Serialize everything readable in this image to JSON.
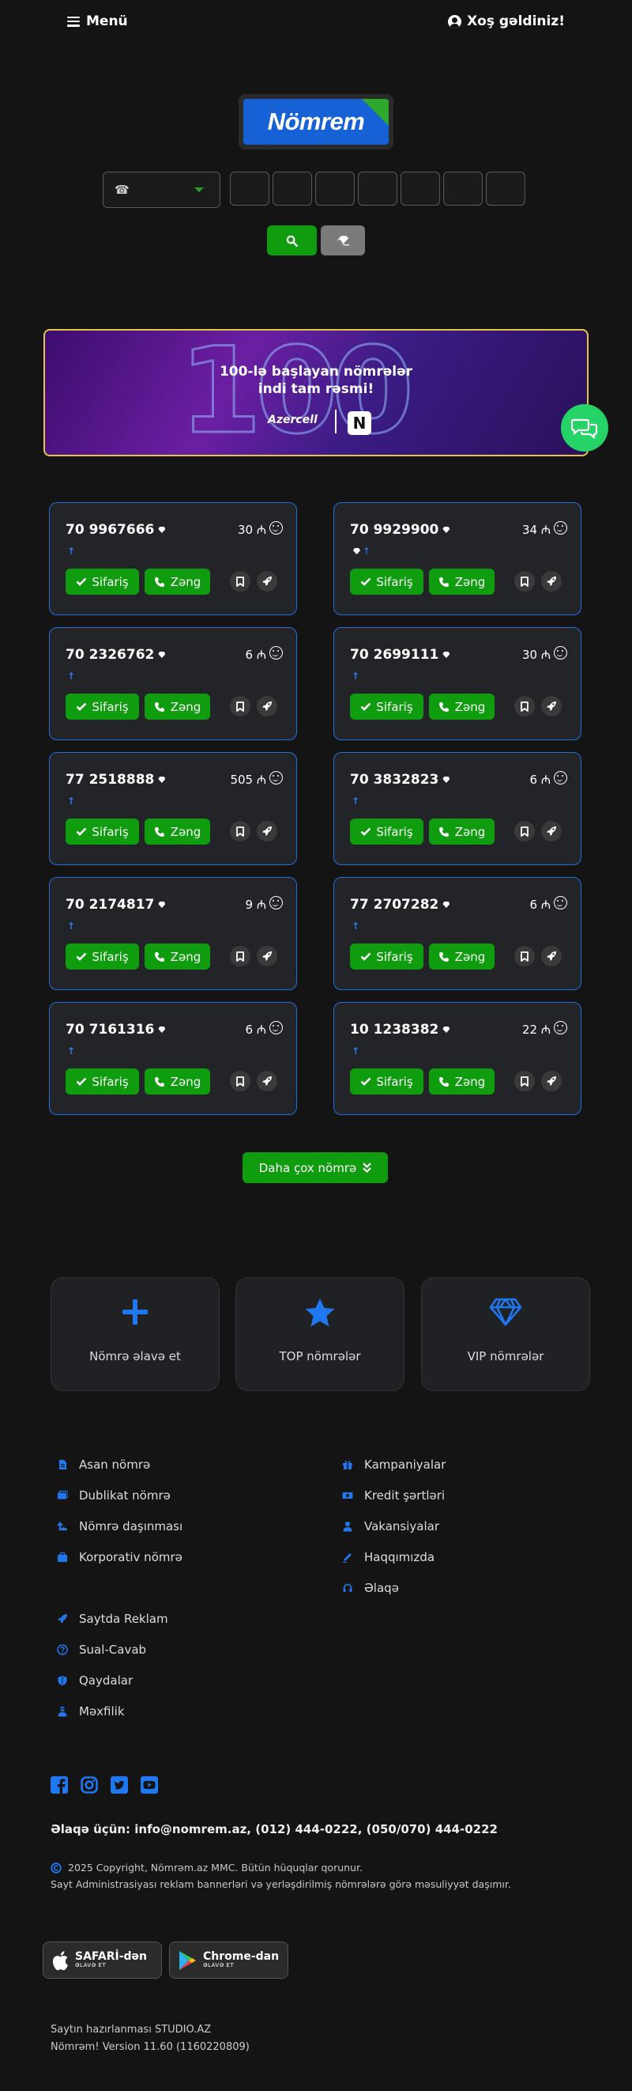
{
  "header": {
    "menu_label": "Menü",
    "welcome": "Xoş gəldiniz!"
  },
  "logo": {
    "text": "Nömrem"
  },
  "search": {
    "operator_placeholder": "☎",
    "digit_count": 7
  },
  "banner": {
    "line1": "100-lə başlayan nömrələr",
    "line2": "indi tam rəsmi!",
    "big": "100",
    "brand": "Azercell",
    "brand2": "N"
  },
  "currency": "₼",
  "cards": [
    {
      "number": "70 9967666",
      "price": "30 ₼",
      "vip": false
    },
    {
      "number": "70 9929900",
      "price": "34 ₼",
      "vip": true
    },
    {
      "number": "70 2326762",
      "price": "6 ₼",
      "vip": false
    },
    {
      "number": "70 2699111",
      "price": "30 ₼",
      "vip": false
    },
    {
      "number": "77 2518888",
      "price": "505 ₼",
      "vip": false
    },
    {
      "number": "70 3832823",
      "price": "6 ₼",
      "vip": false
    },
    {
      "number": "70 2174817",
      "price": "9 ₼",
      "vip": false
    },
    {
      "number": "77 2707282",
      "price": "6 ₼",
      "vip": false
    },
    {
      "number": "70 7161316",
      "price": "6 ₼",
      "vip": false
    },
    {
      "number": "10 1238382",
      "price": "22 ₼",
      "vip": false
    }
  ],
  "card_buttons": {
    "order": "Sifariş",
    "call": "Zəng"
  },
  "more_button": "Daha çox nömrə",
  "tiles": [
    "Nömrə əlavə et",
    "TOP nömrələr",
    "VIP nömrələr"
  ],
  "footer": {
    "col1": [
      "Asan nömrə",
      "Dublikat nömrə",
      "Nömrə daşınması",
      "Korporativ nömrə"
    ],
    "col2": [
      "Kampaniyalar",
      "Kredit şərtləri",
      "Vakansiyalar",
      "Haqqımızda",
      "Əlaqə"
    ],
    "col3": [
      "Saytda Reklam",
      "Sual-Cavab",
      "Qaydalar",
      "Məxfilik"
    ],
    "contact": "Əlaqə üçün: info@nomrem.az, (012) 444-0222, (050/070) 444-0222",
    "copyright": "2025 Copyright, Nömrəm.az MMC. Bütün hüquqlar qorunur.",
    "disclaimer": "Sayt Administrasiyası reklam bannerləri və yerləşdirilmiş nömrələrə görə məsuliyyət daşımır.",
    "safari": {
      "title": "SAFARİ-dən",
      "sub": "ƏLAVƏ ET"
    },
    "chrome": {
      "title": "Chrome-dan",
      "sub": "ƏLAVƏ ET"
    },
    "made_by": "Saytın hazırlanması STUDIO.AZ",
    "version": "Nömrəm! Version 11.60 (1160220809)"
  },
  "colors": {
    "bg": "#141414",
    "green": "#0f9d0f",
    "blue": "#1f6fe0",
    "card_bg": "#222428",
    "banner_border": "#e6c34a"
  }
}
